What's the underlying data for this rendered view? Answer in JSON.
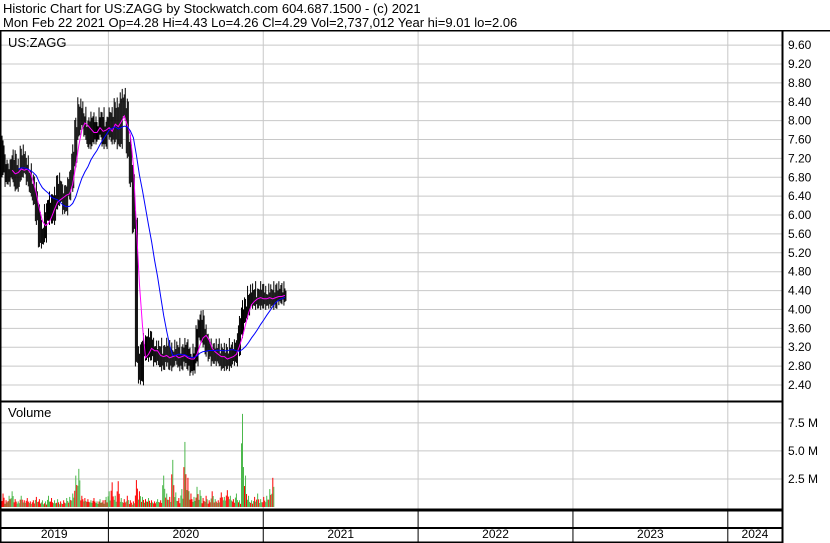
{
  "header": {
    "title": "Historic Chart for US:ZAGG by Stockwatch.com 604.687.1500 - (c) 2021",
    "quote": "Mon Feb 22 2021  Op=4.28  Hi=4.43  Lo=4.26  Cl=4.29  Vol=2,737,012  Year hi=9.01  lo=2.06"
  },
  "chart_data": {
    "type": "line",
    "symbol": "US:ZAGG",
    "volume_label": "Volume",
    "price_ticks": [
      "9.60",
      "9.20",
      "8.80",
      "8.40",
      "8.00",
      "7.60",
      "7.20",
      "6.80",
      "6.40",
      "6.00",
      "5.60",
      "5.20",
      "4.80",
      "4.40",
      "4.00",
      "3.60",
      "3.20",
      "2.80",
      "2.40"
    ],
    "ylim": [
      2.06,
      9.9
    ],
    "volume_ticks": [
      "7.5 M",
      "5.0 M",
      "2.5 M"
    ],
    "volume_ylim": [
      0,
      10
    ],
    "years": [
      "2019",
      "2020",
      "2021",
      "2022",
      "2023",
      "2024"
    ],
    "x_start_year": 2019.3,
    "x_end_year": 2024.35,
    "series_start": 2019.3,
    "series_end": 2021.14,
    "closes": [
      7.4,
      7.0,
      6.8,
      6.9,
      7.1,
      6.7,
      6.9,
      7.2,
      7.0,
      6.8,
      6.6,
      6.4,
      6.0,
      5.5,
      5.6,
      6.0,
      6.2,
      6.0,
      6.3,
      6.6,
      6.4,
      6.2,
      6.5,
      6.7,
      7.2,
      7.8,
      8.2,
      8.0,
      7.8,
      7.6,
      7.9,
      7.7,
      7.8,
      8.0,
      7.6,
      7.8,
      8.0,
      7.7,
      8.2,
      7.6,
      8.4,
      8.2,
      7.4,
      6.8,
      5.8,
      3.0,
      2.6,
      3.2,
      3.1,
      3.3,
      3.1,
      3.0,
      3.1,
      2.9,
      3.0,
      3.1,
      2.9,
      3.0,
      3.1,
      2.9,
      3.0,
      3.1,
      2.9,
      2.8,
      3.0,
      3.5,
      3.7,
      3.4,
      3.2,
      3.1,
      3.0,
      3.1,
      3.0,
      2.9,
      3.0,
      2.9,
      3.1,
      3.0,
      3.2,
      3.6,
      3.9,
      4.0,
      4.2,
      4.3,
      4.2,
      4.2,
      4.3,
      4.2,
      4.2,
      4.3,
      4.2,
      4.3,
      4.3,
      4.3,
      4.29
    ],
    "volumes_millions": [
      0.8,
      1.2,
      0.6,
      1.0,
      1.4,
      0.7,
      0.5,
      1.0,
      0.6,
      0.8,
      0.5,
      0.6,
      0.9,
      0.7,
      0.6,
      0.5,
      1.0,
      0.8,
      0.6,
      0.7,
      0.5,
      0.6,
      0.8,
      0.9,
      1.2,
      2.8,
      3.4,
      1.0,
      0.8,
      0.7,
      0.6,
      0.8,
      0.5,
      0.7,
      0.6,
      0.9,
      1.4,
      2.2,
      1.0,
      2.3,
      0.8,
      0.7,
      1.0,
      0.6,
      0.5,
      2.4,
      1.4,
      0.9,
      0.7,
      0.8,
      0.6,
      0.5,
      0.7,
      0.6,
      2.8,
      1.2,
      0.9,
      4.2,
      1.3,
      0.8,
      1.6,
      5.8,
      2.6,
      1.2,
      0.9,
      1.8,
      1.5,
      0.8,
      1.0,
      0.6,
      1.4,
      0.7,
      0.6,
      1.3,
      0.9,
      1.5,
      1.0,
      0.7,
      1.2,
      0.6,
      8.3,
      2.8,
      1.0,
      0.6,
      0.9,
      1.2,
      0.7,
      0.9,
      1.0,
      1.6,
      2.6
    ],
    "ma_periods": [
      4,
      13
    ],
    "colors": {
      "price": "#000000",
      "ma_short": "#ff00ff",
      "ma_long": "#0000ff",
      "vol_up": "#4cb84c",
      "vol_down": "#ff0000",
      "grid": "#c8c8c8"
    }
  }
}
